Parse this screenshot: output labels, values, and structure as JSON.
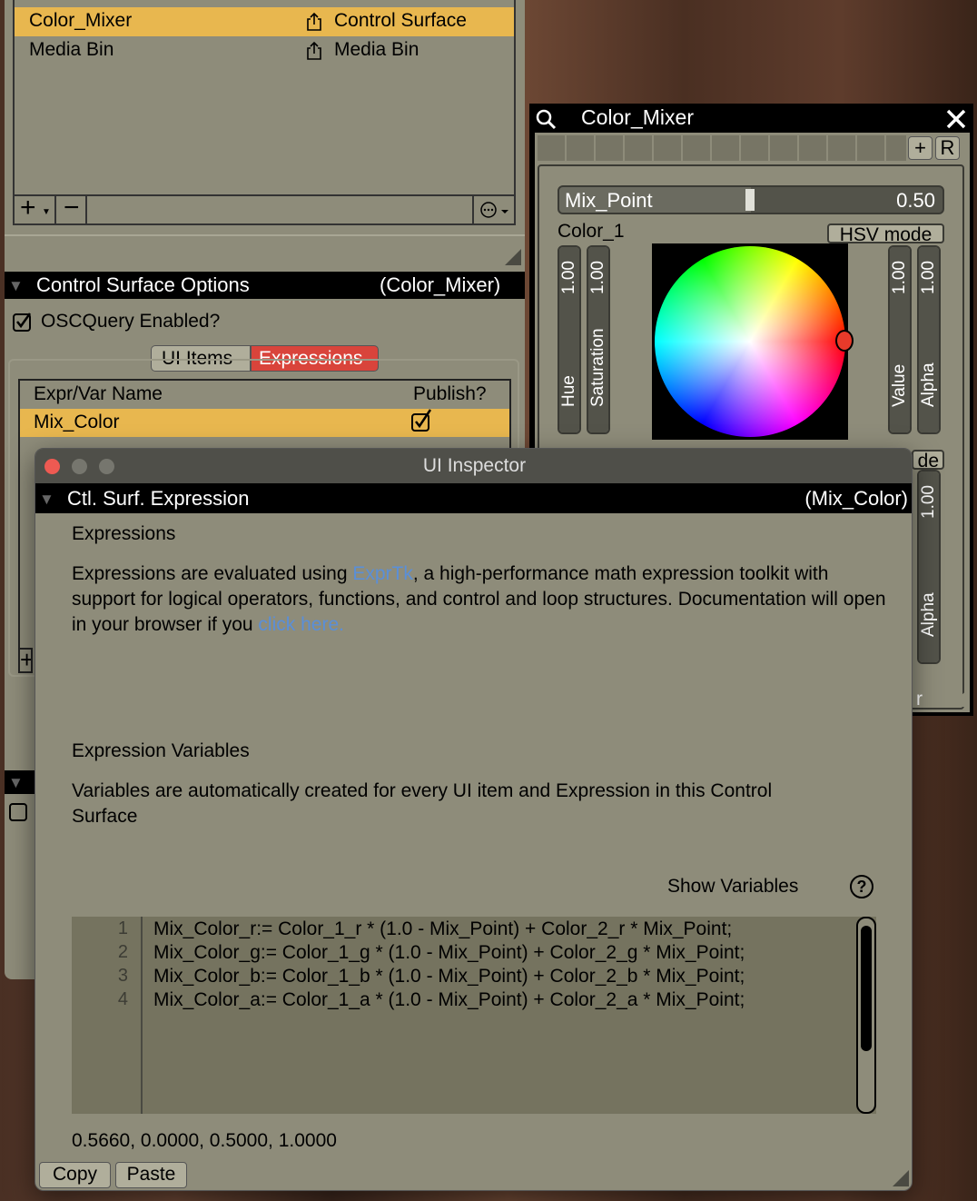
{
  "bin_list": {
    "rows": [
      {
        "name": "Color_Mixer",
        "type": "Control Surface",
        "selected": true
      },
      {
        "name": "Media Bin",
        "type": "Media Bin",
        "selected": false
      }
    ],
    "add_label": "+",
    "remove_label": "−"
  },
  "cs_options": {
    "title": "Control Surface Options",
    "context": "(Color_Mixer)",
    "osc_label": "OSCQuery Enabled?",
    "tabs": [
      "UI Items",
      "Expressions"
    ],
    "active_tab": "Expressions",
    "table": {
      "headers": [
        "Expr/Var Name",
        "Publish?"
      ],
      "rows": [
        {
          "name": "Mix_Color",
          "publish": true
        }
      ]
    }
  },
  "color_mixer": {
    "title": "Color_Mixer",
    "add_label": "+",
    "r_label": "R",
    "mix_point": {
      "label": "Mix_Point",
      "value": "0.50",
      "fraction": 0.5
    },
    "color1": {
      "label": "Color_1",
      "mode_button": "HSV mode",
      "sliders": [
        {
          "label": "Hue",
          "value": "1.00"
        },
        {
          "label": "Saturation",
          "value": "1.00"
        },
        {
          "label": "Value",
          "value": "1.00"
        },
        {
          "label": "Alpha",
          "value": "1.00"
        }
      ]
    },
    "color2": {
      "mode_fragment": "de",
      "alpha": {
        "label": "Alpha",
        "value": "1.00"
      },
      "footer_fragment": "r"
    }
  },
  "inspector": {
    "window_title": "UI Inspector",
    "section_title": "Ctl. Surf. Expression",
    "section_context": "(Mix_Color)",
    "expressions_heading": "Expressions",
    "desc_before": "Expressions are evaluated using ",
    "desc_link": "ExprTk",
    "desc_after": ", a high-performance math expression toolkit with support for logical operators, functions, and control and loop structures. Documentation will open in your browser if you ",
    "desc_link2": "click here.",
    "vars_heading": "Expression Variables",
    "vars_desc": "Variables are automatically created for every UI item and Expression in this Control Surface",
    "show_vars": "Show Variables",
    "help_icon": "?",
    "code": {
      "line_numbers": [
        "1",
        "2",
        "3",
        "4"
      ],
      "lines": [
        "Mix_Color_r:= Color_1_r * (1.0 - Mix_Point) + Color_2_r * Mix_Point;",
        "Mix_Color_g:= Color_1_g * (1.0 - Mix_Point) + Color_2_g * Mix_Point;",
        "Mix_Color_b:= Color_1_b * (1.0 - Mix_Point) + Color_2_b * Mix_Point;",
        "Mix_Color_a:= Color_1_a * (1.0 - Mix_Point) + Color_2_a * Mix_Point;"
      ]
    },
    "result": "0.5660, 0.0000, 0.5000, 1.0000",
    "copy_label": "Copy",
    "paste_label": "Paste"
  },
  "colors": {
    "panel": "#8e8c7a",
    "selection": "#e8b74f",
    "tab_active": "#d9443b",
    "link": "#5a8fd8",
    "close_dot": "#ee5a52",
    "picker_handle": "#e83a2a"
  },
  "icons": [
    "share-icon",
    "search-icon",
    "close-icon",
    "options-icon",
    "help-icon",
    "checkbox-icon",
    "disclosure-triangle-icon",
    "resize-grip-icon"
  ]
}
